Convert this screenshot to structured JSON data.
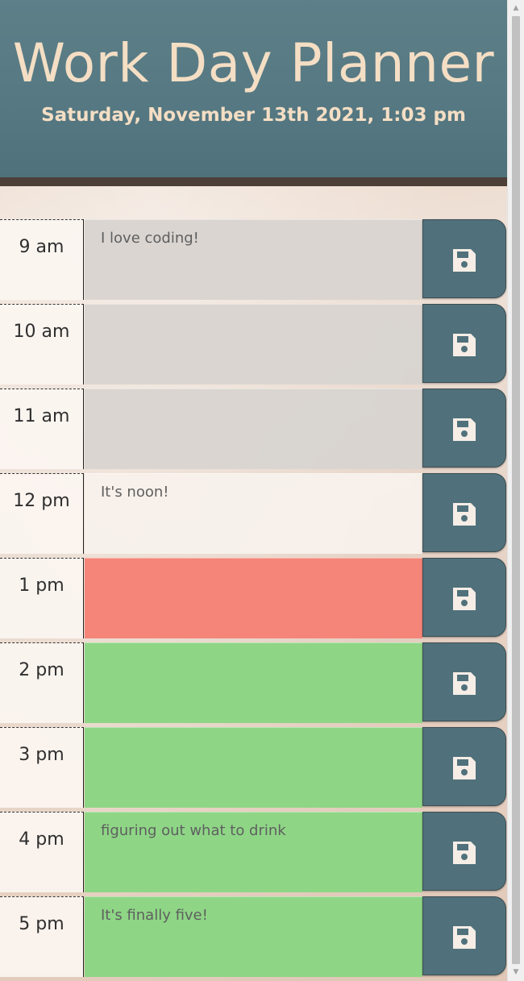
{
  "header": {
    "title": "Work Day Planner",
    "date": "Saturday, November 13th 2021, 1:03 pm"
  },
  "rows": [
    {
      "hour": "9 am",
      "text": "I love coding!",
      "status": "past"
    },
    {
      "hour": "10 am",
      "text": "",
      "status": "past"
    },
    {
      "hour": "11 am",
      "text": "",
      "status": "past"
    },
    {
      "hour": "12 pm",
      "text": "It's noon!",
      "status": "neutral"
    },
    {
      "hour": "1 pm",
      "text": "",
      "status": "present"
    },
    {
      "hour": "2 pm",
      "text": "",
      "status": "future"
    },
    {
      "hour": "3 pm",
      "text": "",
      "status": "future"
    },
    {
      "hour": "4 pm",
      "text": "figuring out what to drink",
      "status": "future"
    },
    {
      "hour": "5 pm",
      "text": "It's finally five!",
      "status": "future"
    }
  ],
  "save_icon": "floppy-disk-icon",
  "colors": {
    "header_bg": "#557882",
    "title_text": "#f4dec4",
    "past": "#d8d4d0",
    "present": "#f48578",
    "future": "#8ed686",
    "save_bg": "#50717b"
  }
}
